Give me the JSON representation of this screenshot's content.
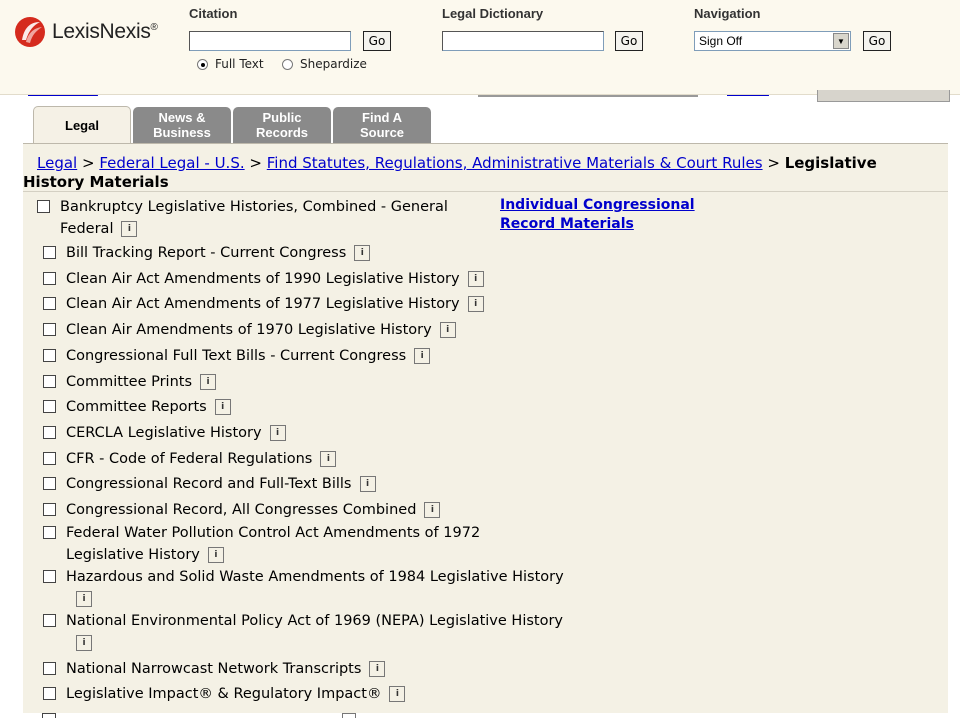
{
  "header": {
    "logo_text": "LexisNexis",
    "logo_mark": "®",
    "citation": {
      "label": "Citation",
      "value": "",
      "go": "Go"
    },
    "radio_full_text": "Full Text",
    "radio_shepardize": "Shepardize",
    "dictionary": {
      "label": "Legal Dictionary",
      "value": "",
      "go": "Go"
    },
    "navigation": {
      "label": "Navigation",
      "selected": "Sign Off",
      "go": "Go"
    },
    "colors": {
      "logo_red": "#d52b1e"
    }
  },
  "tabs": [
    {
      "label": "Legal",
      "active": true
    },
    {
      "label": "News &\nBusiness",
      "active": false
    },
    {
      "label": "Public\nRecords",
      "active": false
    },
    {
      "label": "Find A\nSource",
      "active": false
    }
  ],
  "breadcrumb": {
    "links": [
      "Legal",
      "Federal Legal - U.S.",
      "Find Statutes, Regulations, Administrative Materials & Court Rules"
    ],
    "separator": ">",
    "current": "Legislative History Materials"
  },
  "side_link": "Individual Congressional Record Materials",
  "info_icon": "i",
  "sources": [
    "Bankruptcy Legislative Histories, Combined - General Federal",
    "Bill Tracking Report - Current Congress",
    "Clean Air Act Amendments of 1990 Legislative History",
    "Clean Air Act Amendments of 1977 Legislative History",
    "Clean Air Amendments of 1970 Legislative History",
    "Congressional Full Text Bills - Current Congress",
    "Committee Prints",
    "Committee Reports",
    "CERCLA Legislative History",
    "CFR - Code of Federal Regulations",
    "Congressional Record and Full-Text Bills",
    "Congressional Record, All Congresses Combined",
    "Federal Water Pollution Control Act Amendments of 1972 Legislative History",
    "Hazardous and Solid Waste Amendments of 1984 Legislative History",
    "National Environmental Policy Act of 1969 (NEPA) Legislative History",
    "National Narrowcast Network Transcripts",
    "Legislative Impact® & Regulatory Impact®"
  ]
}
